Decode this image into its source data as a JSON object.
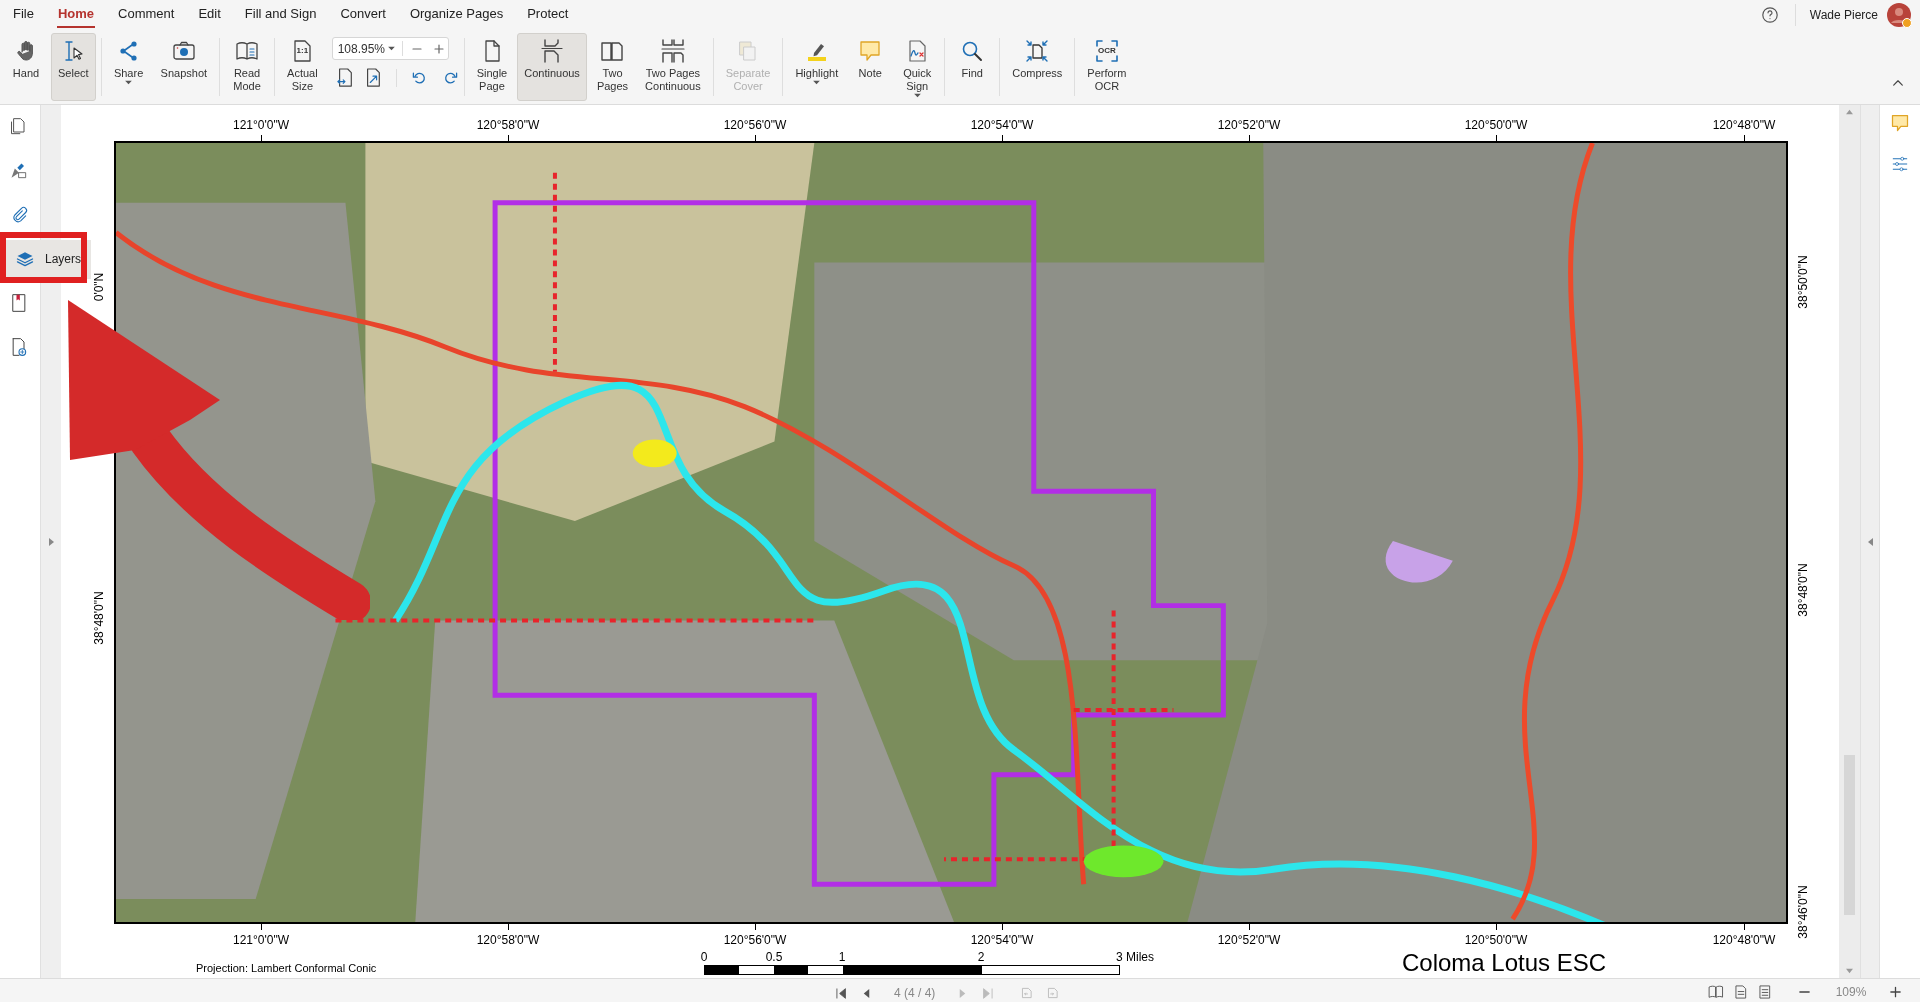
{
  "menu_tabs": [
    {
      "label": "File",
      "selected": false
    },
    {
      "label": "Home",
      "selected": true
    },
    {
      "label": "Comment",
      "selected": false
    },
    {
      "label": "Edit",
      "selected": false
    },
    {
      "label": "Fill and Sign",
      "selected": false
    },
    {
      "label": "Convert",
      "selected": false
    },
    {
      "label": "Organize Pages",
      "selected": false
    },
    {
      "label": "Protect",
      "selected": false
    }
  ],
  "user": {
    "name": "Wade Pierce"
  },
  "toolbar": [
    [
      {
        "kind": "tool",
        "label": "Hand",
        "selected": false,
        "disabled": false,
        "dropdown": false
      },
      {
        "kind": "tool",
        "label": "Select",
        "selected": true,
        "disabled": false,
        "dropdown": false
      }
    ],
    [
      {
        "kind": "tool",
        "label": "Share",
        "selected": false,
        "disabled": false,
        "dropdown": true
      },
      {
        "kind": "tool",
        "label": "Snapshot",
        "selected": false,
        "disabled": false,
        "dropdown": false
      }
    ],
    [
      {
        "kind": "tool",
        "label": "Read\nMode",
        "selected": false,
        "disabled": false,
        "dropdown": false
      }
    ],
    [
      {
        "kind": "tool",
        "label": "Actual\nSize",
        "icon_text": "1:1",
        "selected": false,
        "disabled": false,
        "dropdown": false
      },
      {
        "kind": "zoom",
        "value": "108.95%"
      }
    ],
    [
      {
        "kind": "tool",
        "label": "Single\nPage",
        "selected": false,
        "disabled": false,
        "dropdown": false
      },
      {
        "kind": "tool",
        "label": "Continuous",
        "selected": true,
        "disabled": false,
        "dropdown": false
      },
      {
        "kind": "tool",
        "label": "Two\nPages",
        "selected": false,
        "disabled": false,
        "dropdown": false
      },
      {
        "kind": "tool",
        "label": "Two Pages\nContinuous",
        "selected": false,
        "disabled": false,
        "dropdown": false
      }
    ],
    [
      {
        "kind": "tool",
        "label": "Separate\nCover",
        "selected": false,
        "disabled": true,
        "dropdown": false
      }
    ],
    [
      {
        "kind": "tool",
        "label": "Highlight",
        "selected": false,
        "disabled": false,
        "dropdown": true
      },
      {
        "kind": "tool",
        "label": "Note",
        "selected": false,
        "disabled": false,
        "dropdown": false
      },
      {
        "kind": "tool",
        "label": "Quick\nSign",
        "selected": false,
        "disabled": false,
        "dropdown": true
      }
    ],
    [
      {
        "kind": "tool",
        "label": "Find",
        "selected": false,
        "disabled": false,
        "dropdown": false
      }
    ],
    [
      {
        "kind": "tool",
        "label": "Compress",
        "selected": false,
        "disabled": false,
        "dropdown": false
      }
    ],
    [
      {
        "kind": "tool",
        "label": "Perform\nOCR",
        "icon_text": "OCR",
        "selected": false,
        "disabled": false,
        "dropdown": false
      }
    ]
  ],
  "left_panel": [
    {
      "selected": false
    },
    {
      "selected": false
    },
    {
      "selected": false
    },
    {
      "selected": true,
      "label": "Layers"
    },
    {
      "selected": false
    },
    {
      "selected": false
    }
  ],
  "document": {
    "top_longitudes": [
      "121°0'0\"W",
      "120°58'0\"W",
      "120°56'0\"W",
      "120°54'0\"W",
      "120°52'0\"W",
      "120°50'0\"W",
      "120°48'0\"W"
    ],
    "bottom_longitudes": [
      "121°0'0\"W",
      "120°58'0\"W",
      "120°56'0\"W",
      "120°54'0\"W",
      "120°52'0\"W",
      "120°50'0\"W",
      "120°48'0\"W"
    ],
    "right_latitudes": [
      "38°50'0\"N",
      "38°48'0\"N",
      "38°46'0\"N"
    ],
    "left_latitudes": [
      "0'0\"N",
      "38°48'0\"N"
    ],
    "map": {
      "kind": "picture"
    },
    "scale_bar": {
      "labels": [
        "0",
        "0.5",
        "1",
        "2",
        "3 Miles"
      ]
    },
    "projection": "Projection: Lambert Conformal Conic",
    "title": "Coloma Lotus ESC"
  },
  "annotations": {
    "highlight_box": true,
    "arrow": true
  },
  "status_bar": {
    "page_indicator": "4 (4 / 4)",
    "zoom_level": "109%"
  }
}
